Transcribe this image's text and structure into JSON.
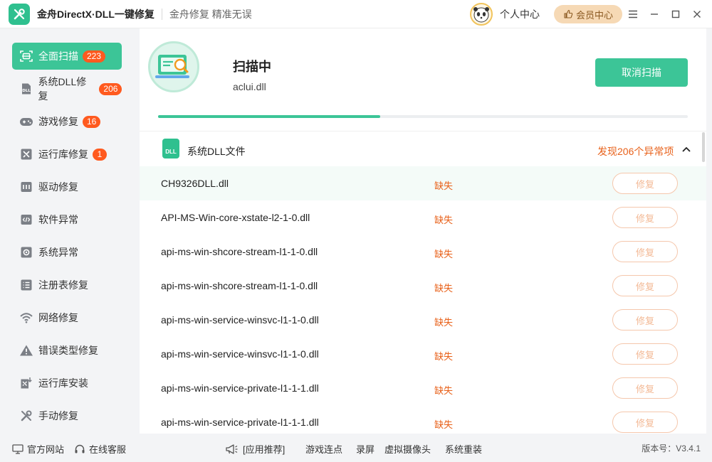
{
  "app": {
    "title": "金舟DirectX·DLL一键修复",
    "slogan": "金舟修复 精准无误",
    "user_center": "个人中心",
    "vip_center": "会员中心"
  },
  "sidebar": {
    "items": [
      {
        "label": "全面扫描",
        "badge": "223",
        "icon": "scan-icon"
      },
      {
        "label": "系统DLL修复",
        "badge": "206",
        "icon": "dll-icon"
      },
      {
        "label": "游戏修复",
        "badge": "16",
        "icon": "gamepad-icon"
      },
      {
        "label": "运行库修复",
        "badge": "1",
        "icon": "runtime-icon"
      },
      {
        "label": "驱动修复",
        "icon": "driver-icon"
      },
      {
        "label": "软件异常",
        "icon": "code-icon"
      },
      {
        "label": "系统异常",
        "icon": "gear-icon"
      },
      {
        "label": "注册表修复",
        "icon": "list-icon"
      },
      {
        "label": "网络修复",
        "icon": "wifi-icon"
      },
      {
        "label": "错误类型修复",
        "icon": "warning-icon"
      },
      {
        "label": "运行库安装",
        "icon": "runtime-install-icon"
      },
      {
        "label": "手动修复",
        "icon": "wrench-icon"
      }
    ]
  },
  "scan": {
    "title": "扫描中",
    "current_file": "aclui.dll",
    "cancel_label": "取消扫描",
    "progress": 0.42
  },
  "section": {
    "icon_text": "DLL",
    "title": "系统DLL文件",
    "found": "发现206个异常项"
  },
  "rows": [
    {
      "name": "CH9326DLL.dll",
      "status": "缺失",
      "action": "修复"
    },
    {
      "name": "API-MS-Win-core-xstate-l2-1-0.dll",
      "status": "缺失",
      "action": "修复"
    },
    {
      "name": "api-ms-win-shcore-stream-l1-1-0.dll",
      "status": "缺失",
      "action": "修复"
    },
    {
      "name": "api-ms-win-shcore-stream-l1-1-0.dll",
      "status": "缺失",
      "action": "修复"
    },
    {
      "name": "api-ms-win-service-winsvc-l1-1-0.dll",
      "status": "缺失",
      "action": "修复"
    },
    {
      "name": "api-ms-win-service-winsvc-l1-1-0.dll",
      "status": "缺失",
      "action": "修复"
    },
    {
      "name": "api-ms-win-service-private-l1-1-1.dll",
      "status": "缺失",
      "action": "修复"
    },
    {
      "name": "api-ms-win-service-private-l1-1-1.dll",
      "status": "缺失",
      "action": "修复"
    }
  ],
  "footer": {
    "website": "官方网站",
    "support": "在线客服",
    "recommend": "[应用推荐]",
    "links": [
      "游戏连点",
      "录屏",
      "虚拟摄像头",
      "系统重装"
    ],
    "version": "版本号：V3.4.1"
  },
  "colors": {
    "accent": "#3cc597",
    "warning": "#e8611a",
    "badge": "#ff5a1f"
  }
}
